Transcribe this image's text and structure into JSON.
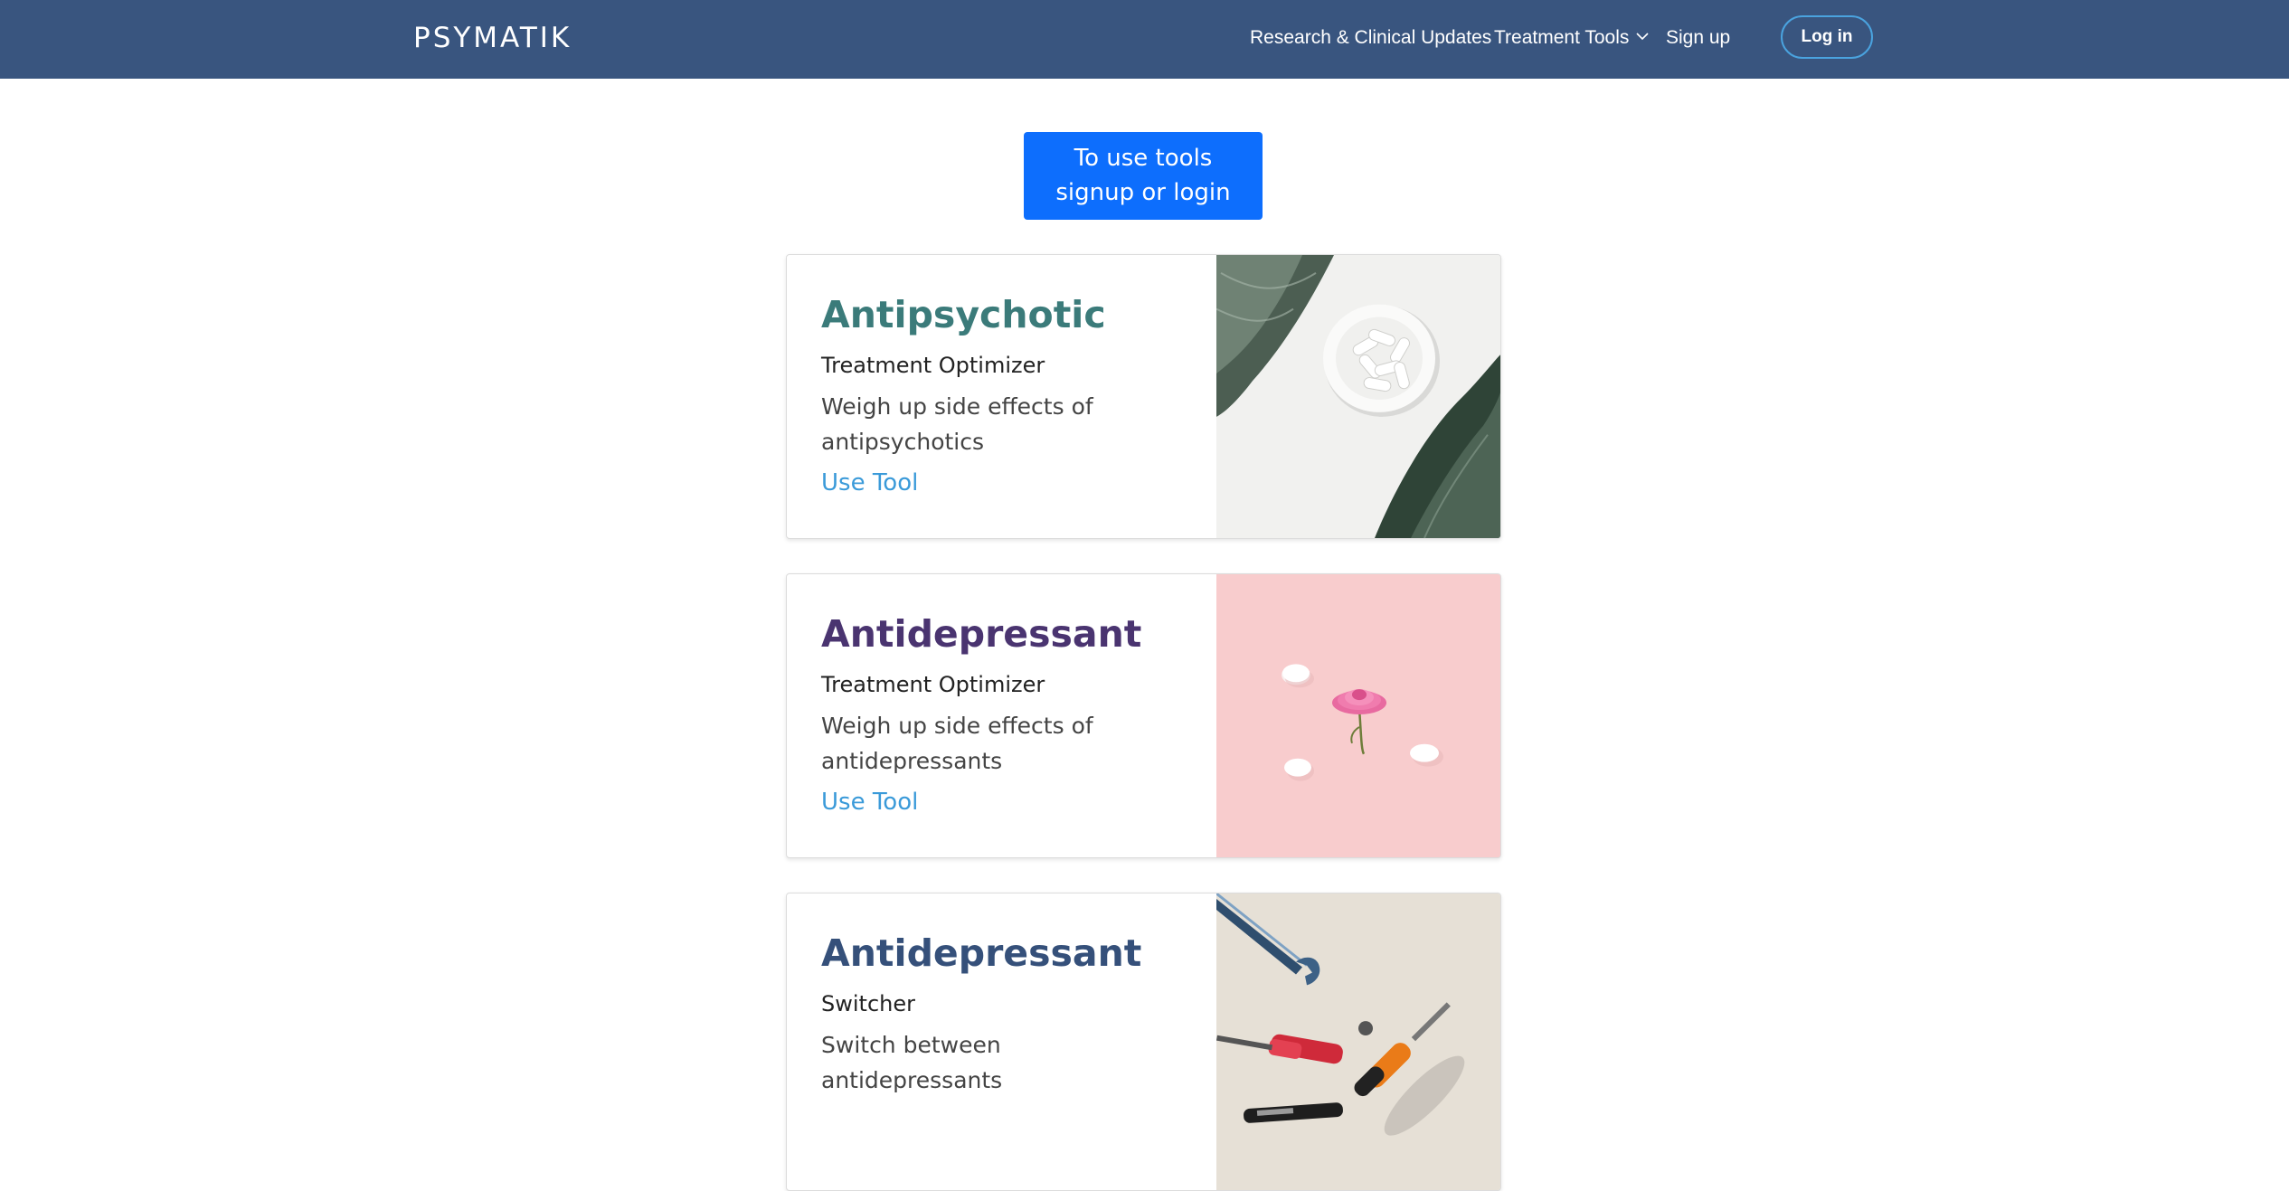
{
  "header": {
    "logo": "PSYMATIK",
    "nav": {
      "research": "Research & Clinical Updates",
      "tools": "Treatment Tools",
      "signup": "Sign up",
      "login": "Log in"
    }
  },
  "cta": {
    "line1": "To use tools",
    "line2": "signup or login"
  },
  "cards": [
    {
      "title": "Antipsychotic",
      "subtitle": "Treatment Optimizer",
      "text": "Weigh up side effects of antipsychotics",
      "link": "Use Tool",
      "title_color": "#3b7b7a",
      "image": "pills-bowl-with-leaves"
    },
    {
      "title": "Antidepressant",
      "subtitle": "Treatment Optimizer",
      "text": "Weigh up side effects of antidepressants",
      "link": "Use Tool",
      "title_color": "#4a3470",
      "image": "pink-flower-with-pills"
    },
    {
      "title": "Antidepressant",
      "subtitle": "Switcher",
      "text": "Switch between antidepressants",
      "title_color": "#35507a",
      "image": "hand-tools"
    }
  ],
  "colors": {
    "navbar": "#39557f",
    "cta": "#0d6efd",
    "link": "#3a9ad9"
  }
}
